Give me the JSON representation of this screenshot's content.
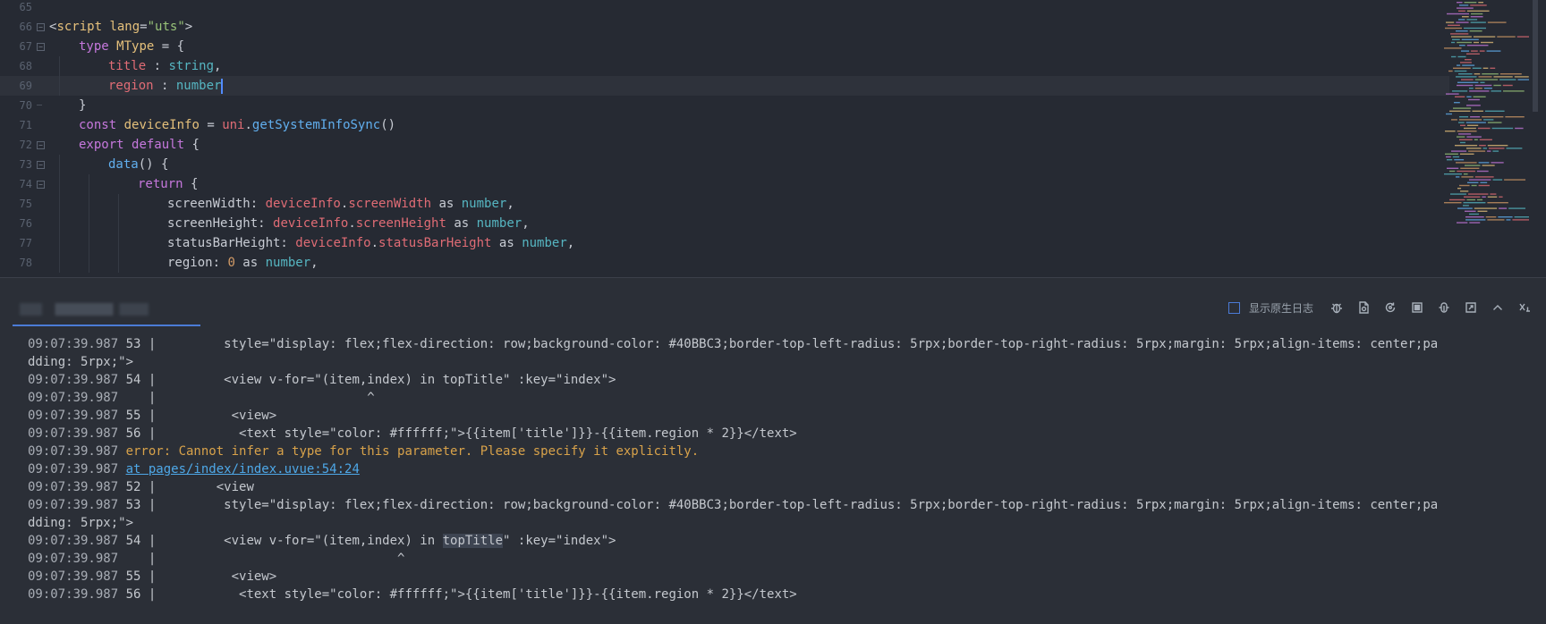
{
  "editor": {
    "lines": [
      {
        "n": "65",
        "fold": "",
        "indent": 0,
        "tokens": []
      },
      {
        "n": "66",
        "fold": "open",
        "indent": 0,
        "tokens": [
          [
            "t-plain",
            "<"
          ],
          [
            "t-tag",
            "script"
          ],
          [
            "t-plain",
            " "
          ],
          [
            "t-tag",
            "lang"
          ],
          [
            "t-plain",
            "="
          ],
          [
            "t-str",
            "\"uts\""
          ],
          [
            "t-plain",
            ">"
          ]
        ]
      },
      {
        "n": "67",
        "fold": "open",
        "indent": 1,
        "tokens": [
          [
            "t-kw",
            "type"
          ],
          [
            "t-plain",
            " "
          ],
          [
            "t-tag",
            "MType"
          ],
          [
            "t-plain",
            " = {"
          ]
        ]
      },
      {
        "n": "68",
        "fold": "",
        "indent": 2,
        "tokens": [
          [
            "t-prop",
            "title"
          ],
          [
            "t-plain",
            " : "
          ],
          [
            "t-type",
            "string"
          ],
          [
            "t-plain",
            ","
          ]
        ]
      },
      {
        "n": "69",
        "fold": "",
        "indent": 2,
        "current": true,
        "tokens": [
          [
            "t-prop",
            "region"
          ],
          [
            "t-plain",
            " : "
          ],
          [
            "t-type",
            "number"
          ]
        ]
      },
      {
        "n": "70",
        "fold": "end",
        "indent": 1,
        "tokens": [
          [
            "t-plain",
            "}"
          ]
        ]
      },
      {
        "n": "71",
        "fold": "",
        "indent": 1,
        "tokens": [
          [
            "t-kw",
            "const"
          ],
          [
            "t-plain",
            " "
          ],
          [
            "t-tag",
            "deviceInfo"
          ],
          [
            "t-plain",
            " = "
          ],
          [
            "t-prop",
            "uni"
          ],
          [
            "t-plain",
            "."
          ],
          [
            "t-fn",
            "getSystemInfoSync"
          ],
          [
            "t-plain",
            "()"
          ]
        ]
      },
      {
        "n": "72",
        "fold": "open",
        "indent": 1,
        "tokens": [
          [
            "t-kw",
            "export"
          ],
          [
            "t-plain",
            " "
          ],
          [
            "t-kw",
            "default"
          ],
          [
            "t-plain",
            " {"
          ]
        ]
      },
      {
        "n": "73",
        "fold": "open",
        "indent": 2,
        "tokens": [
          [
            "t-fn",
            "data"
          ],
          [
            "t-plain",
            "() {"
          ]
        ]
      },
      {
        "n": "74",
        "fold": "open",
        "indent": 3,
        "tokens": [
          [
            "t-kw",
            "return"
          ],
          [
            "t-plain",
            " {"
          ]
        ]
      },
      {
        "n": "75",
        "fold": "",
        "indent": 4,
        "tokens": [
          [
            "t-plain",
            "screenWidth: "
          ],
          [
            "t-prop",
            "deviceInfo"
          ],
          [
            "t-plain",
            "."
          ],
          [
            "t-prop",
            "screenWidth"
          ],
          [
            "t-plain",
            " as "
          ],
          [
            "t-type",
            "number"
          ],
          [
            "t-plain",
            ","
          ]
        ]
      },
      {
        "n": "76",
        "fold": "",
        "indent": 4,
        "tokens": [
          [
            "t-plain",
            "screenHeight: "
          ],
          [
            "t-prop",
            "deviceInfo"
          ],
          [
            "t-plain",
            "."
          ],
          [
            "t-prop",
            "screenHeight"
          ],
          [
            "t-plain",
            " as "
          ],
          [
            "t-type",
            "number"
          ],
          [
            "t-plain",
            ","
          ]
        ]
      },
      {
        "n": "77",
        "fold": "",
        "indent": 4,
        "tokens": [
          [
            "t-plain",
            "statusBarHeight: "
          ],
          [
            "t-prop",
            "deviceInfo"
          ],
          [
            "t-plain",
            "."
          ],
          [
            "t-prop",
            "statusBarHeight"
          ],
          [
            "t-plain",
            " as "
          ],
          [
            "t-type",
            "number"
          ],
          [
            "t-plain",
            ","
          ]
        ]
      },
      {
        "n": "78",
        "fold": "",
        "indent": 4,
        "tokens": [
          [
            "t-plain",
            "region: "
          ],
          [
            "t-num",
            "0"
          ],
          [
            "t-plain",
            " as "
          ],
          [
            "t-type",
            "number"
          ],
          [
            "t-plain",
            ","
          ]
        ]
      }
    ]
  },
  "console": {
    "tab_label": "████  ███████ █",
    "native_log_label": "显示原生日志",
    "toolbar_icons": [
      "bug-icon",
      "refresh-doc-icon",
      "restart-icon",
      "stop-icon",
      "debug-icon",
      "export-log-icon",
      "collapse-up-icon",
      "clear-icon"
    ],
    "lines": [
      [
        [
          "log-ts",
          "09:07:39.987 "
        ],
        [
          "",
          "53 |         style=\"display: flex;flex-direction: row;background-color: #40BBC3;border-top-left-radius: 5rpx;border-top-right-radius: 5rpx;margin: 5rpx;align-items: center;pa"
        ]
      ],
      [
        [
          "",
          "dding: 5rpx;\">"
        ]
      ],
      [
        [
          "log-ts",
          "09:07:39.987 "
        ],
        [
          "",
          "54 |         <view v-for=\"(item,index) in topTitle\" :key=\"index\">"
        ]
      ],
      [
        [
          "log-ts",
          "09:07:39.987 "
        ],
        [
          "",
          "   |                            ^"
        ]
      ],
      [
        [
          "log-ts",
          "09:07:39.987 "
        ],
        [
          "",
          "55 |          <view>"
        ]
      ],
      [
        [
          "log-ts",
          "09:07:39.987 "
        ],
        [
          "",
          "56 |           <text style=\"color: #ffffff;\">{{item['title']}}-{{item.region * 2}}</text>"
        ]
      ],
      [
        [
          "log-ts",
          "09:07:39.987 "
        ],
        [
          "log-err",
          "error: Cannot infer a type for this parameter. Please specify it explicitly."
        ]
      ],
      [
        [
          "log-ts",
          "09:07:39.987 "
        ],
        [
          "log-link",
          "at pages/index/index.uvue:54:24"
        ]
      ],
      [
        [
          "log-ts",
          "09:07:39.987 "
        ],
        [
          "",
          "52 |        <view"
        ]
      ],
      [
        [
          "log-ts",
          "09:07:39.987 "
        ],
        [
          "",
          "53 |         style=\"display: flex;flex-direction: row;background-color: #40BBC3;border-top-left-radius: 5rpx;border-top-right-radius: 5rpx;margin: 5rpx;align-items: center;pa"
        ]
      ],
      [
        [
          "",
          "dding: 5rpx;\">"
        ]
      ],
      [
        [
          "log-ts",
          "09:07:39.987 "
        ],
        [
          "",
          "54 |         <view v-for=\"(item,index) in "
        ],
        [
          "hl",
          "topTitle"
        ],
        [
          "",
          "\" :key=\"index\">"
        ]
      ],
      [
        [
          "log-ts",
          "09:07:39.987 "
        ],
        [
          "",
          "   |                                ^"
        ]
      ],
      [
        [
          "log-ts",
          "09:07:39.987 "
        ],
        [
          "",
          "55 |          <view>"
        ]
      ],
      [
        [
          "log-ts",
          "09:07:39.987 "
        ],
        [
          "",
          "56 |           <text style=\"color: #ffffff;\">{{item['title']}}-{{item.region * 2}}</text>"
        ]
      ]
    ]
  },
  "colors": {
    "editor_bg": "#262a33",
    "console_bg": "#2b2f37",
    "accent": "#4b7bd6",
    "error": "#d8a24a",
    "link": "#4ea8e8"
  }
}
